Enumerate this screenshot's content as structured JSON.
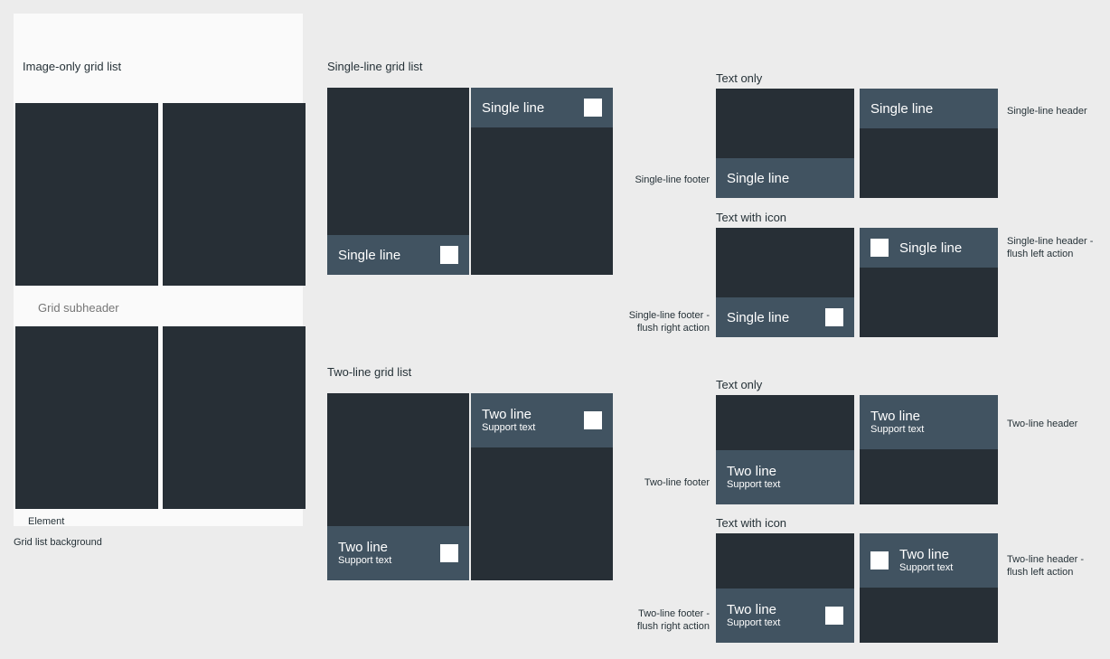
{
  "colors": {
    "page_background": "#ececec",
    "panel_background": "#fafafa",
    "tile_image": "#272f36",
    "overlay_bar": "#415361",
    "action_icon": "#ffffff",
    "text_dark": "#263238",
    "subheader_text": "#767676",
    "overlay_text": "#ffffff"
  },
  "left_panel": {
    "title": "Image-only grid list",
    "subheader": "Grid subheader",
    "element_label": "Element",
    "background_label": "Grid list background",
    "tiles": [
      {
        "name": "tile-1"
      },
      {
        "name": "tile-2"
      },
      {
        "name": "tile-3"
      },
      {
        "name": "tile-4"
      }
    ]
  },
  "middle_column": {
    "single_line": {
      "title": "Single-line grid list",
      "tile_footer": {
        "primary": "Single line",
        "action_icon": "square-action-icon"
      },
      "tile_header": {
        "primary": "Single line",
        "action_icon": "square-action-icon"
      }
    },
    "two_line": {
      "title": "Two-line grid list",
      "tile_footer": {
        "primary": "Two line",
        "secondary": "Support text",
        "action_icon": "square-action-icon"
      },
      "tile_header": {
        "primary": "Two line",
        "secondary": "Support text",
        "action_icon": "square-action-icon"
      }
    }
  },
  "right_column": {
    "groups": [
      {
        "title": "Text only",
        "footer_note": "Single-line footer",
        "header_note": "Single-line header",
        "footer_tile": {
          "primary": "Single line"
        },
        "header_tile": {
          "primary": "Single line"
        }
      },
      {
        "title": "Text with icon",
        "footer_note": "Single-line footer -\nflush right action",
        "header_note": "Single-line header -\nflush left action",
        "footer_tile": {
          "primary": "Single line",
          "action_icon": "square-action-icon"
        },
        "header_tile": {
          "primary": "Single line",
          "action_icon": "square-action-icon"
        }
      },
      {
        "title": "Text only",
        "footer_note": "Two-line footer",
        "header_note": "Two-line header",
        "footer_tile": {
          "primary": "Two line",
          "secondary": "Support text"
        },
        "header_tile": {
          "primary": "Two line",
          "secondary": "Support text"
        }
      },
      {
        "title": "Text with icon",
        "footer_note": "Two-line footer -\nflush right action",
        "header_note": "Two-line header -\nflush left action",
        "footer_tile": {
          "primary": "Two line",
          "secondary": "Support text",
          "action_icon": "square-action-icon"
        },
        "header_tile": {
          "primary": "Two line",
          "secondary": "Support text",
          "action_icon": "square-action-icon"
        }
      }
    ]
  }
}
